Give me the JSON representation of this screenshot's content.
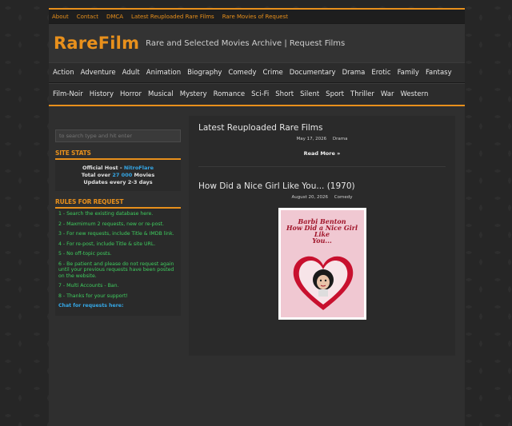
{
  "topnav": [
    "About",
    "Contact",
    "DMCA",
    "Latest Reuploaded Rare Films",
    "Rare Movies of Request"
  ],
  "site": {
    "logo": "RareFilm",
    "tagline": "Rare and Selected Movies Archive | Request Films"
  },
  "genres_row1": [
    "Action",
    "Adventure",
    "Adult",
    "Animation",
    "Biography",
    "Comedy",
    "Crime",
    "Documentary",
    "Drama",
    "Erotic",
    "Family",
    "Fantasy"
  ],
  "genres_row2": [
    "Film-Noir",
    "History",
    "Horror",
    "Musical",
    "Mystery",
    "Romance",
    "Sci-Fi",
    "Short",
    "Silent",
    "Sport",
    "Thriller",
    "War",
    "Western"
  ],
  "sidebar": {
    "search_placeholder": "to search type and hit enter",
    "stats_title": "SITE STATS",
    "stats": {
      "line1_prefix": "Official Host - ",
      "line1_host": "NitroFlare",
      "line2_prefix": "Total over ",
      "line2_count": "27 000",
      "line2_suffix": " Movies",
      "line3": "Updates every 2-3 days"
    },
    "rules_title": "RULES FOR REQUEST",
    "rules": [
      "1 - Search the existing database here.",
      "2 - Maxmimum 2 requests, new or re-post.",
      "3 - For new requests, include Title & IMDB link.",
      "4 - For re-post, include Title & site URL.",
      "5 - No off-topic posts.",
      "6 - Be patient and please do not request again until your previous requests have been posted on the website.",
      "7 - Multi Accounts - Ban.",
      "8 - Thanks for your support!"
    ],
    "chat_label": "Chat for requests here:"
  },
  "posts": [
    {
      "title": "Latest Reuploaded Rare Films",
      "date": "May 17, 2026",
      "category": "Drama",
      "readmore": "Read More »"
    },
    {
      "title": "How Did a Nice Girl Like You... (1970)",
      "date": "August 20, 2026",
      "category": "Comedy",
      "poster_text_line1": "Barbi Benton",
      "poster_text_line2": "How Did a Nice Girl",
      "poster_text_line3": "Like",
      "poster_text_line4": "You..."
    }
  ],
  "colors": {
    "accent": "#e8901c",
    "link_blue": "#35a7e6",
    "rules_green": "#3fcf5f"
  }
}
